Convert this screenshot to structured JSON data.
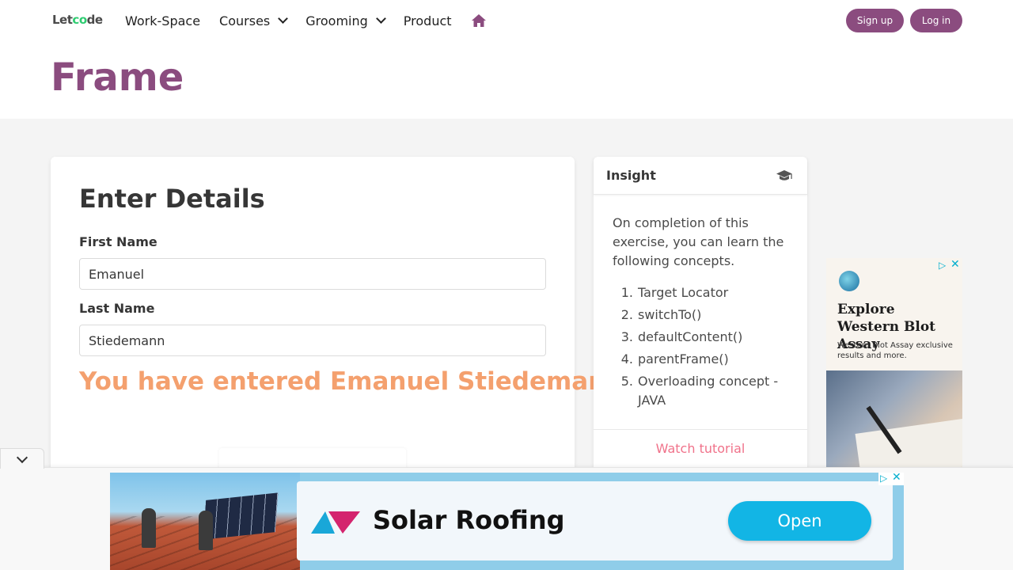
{
  "header": {
    "logo_text": "Letcode",
    "nav": {
      "workspace": "Work-Space",
      "courses": "Courses",
      "grooming": "Grooming",
      "product": "Product"
    },
    "signup_label": "Sign up",
    "login_label": "Log in"
  },
  "page_title": "Frame",
  "form": {
    "heading": "Enter Details",
    "first_name_label": "First Name",
    "first_name_value": "Emanuel",
    "last_name_label": "Last Name",
    "last_name_value": "Stiedemann",
    "result_text": "You have entered Emanuel Stiedemann"
  },
  "insight": {
    "title": "Insight",
    "intro": "On completion of this exercise, you can learn the following concepts.",
    "concepts": [
      {
        "num": "1.",
        "text": "Target Locator"
      },
      {
        "num": "2.",
        "text": "switchTo()"
      },
      {
        "num": "3.",
        "text": "defaultContent()"
      },
      {
        "num": "4.",
        "text": "parentFrame()"
      },
      {
        "num": "5.",
        "text": "Overloading concept - JAVA"
      }
    ],
    "watch_label": "Watch tutorial"
  },
  "side_ad": {
    "title": "Explore Western Blot Assay",
    "subtitle": "Western Blot Assay exclusive results and more."
  },
  "banner_ad": {
    "title": "Solar Roofing",
    "button_label": "Open"
  },
  "colors": {
    "brand": "#8b4c7f",
    "result": "#f4a06e",
    "link": "#f0728a",
    "ad_button": "#12b5e5"
  },
  "icons": {
    "home": "home-icon",
    "insight": "graduation-cap-icon",
    "collapse": "chevron-down-icon"
  }
}
